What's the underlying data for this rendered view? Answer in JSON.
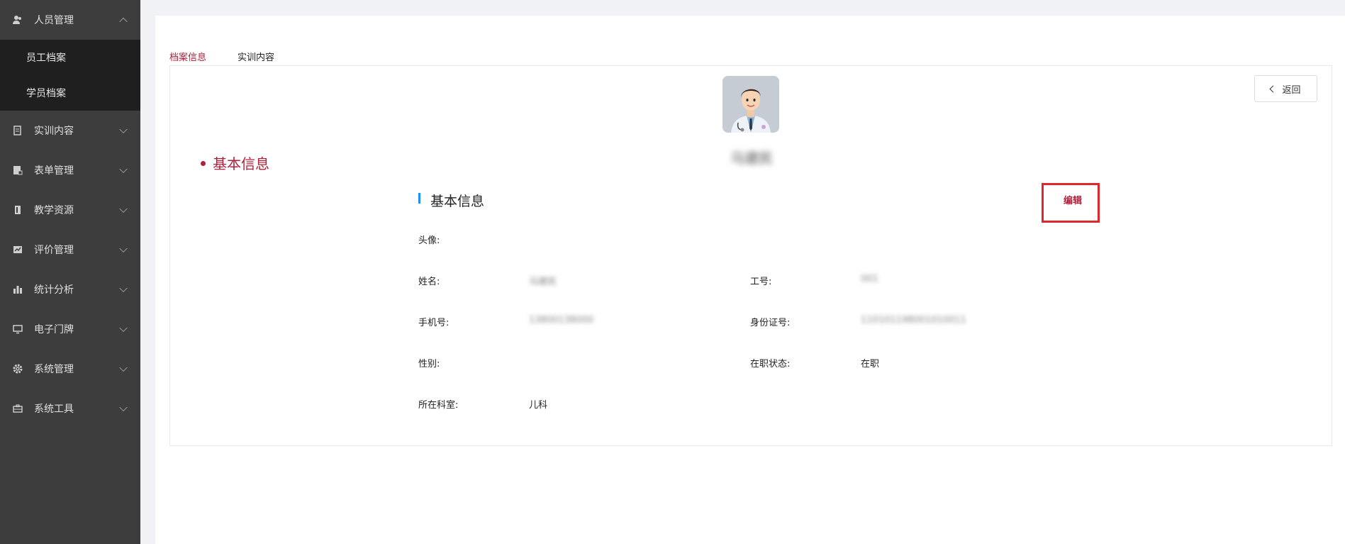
{
  "sidebar": {
    "items": [
      {
        "label": "人员管理",
        "icon": "user-group-icon",
        "expanded": true,
        "children": [
          {
            "label": "员工档案"
          },
          {
            "label": "学员档案"
          }
        ]
      },
      {
        "label": "实训内容",
        "icon": "document-icon"
      },
      {
        "label": "表单管理",
        "icon": "form-icon"
      },
      {
        "label": "教学资源",
        "icon": "book-icon"
      },
      {
        "label": "评价管理",
        "icon": "evaluation-icon"
      },
      {
        "label": "统计分析",
        "icon": "bar-chart-icon"
      },
      {
        "label": "电子门牌",
        "icon": "monitor-icon"
      },
      {
        "label": "系统管理",
        "icon": "gear-icon"
      },
      {
        "label": "系统工具",
        "icon": "toolbox-icon"
      }
    ]
  },
  "tabs": [
    {
      "label": "档案信息",
      "active": true
    },
    {
      "label": "实训内容",
      "active": false
    }
  ],
  "card": {
    "back_label": "返回",
    "profile_name": "马建民",
    "side_title": "基本信息",
    "section_title": "基本信息",
    "edit_label": "编辑",
    "fields": {
      "avatar_label": "头像:",
      "name_label": "姓名:",
      "name_value": "马建民",
      "id_label": "工号:",
      "id_value": "001",
      "phone_label": "手机号:",
      "phone_value": "13800138000",
      "idcard_label": "身份证号:",
      "idcard_value": "110101198001010011",
      "gender_label": "性别:",
      "gender_value": "",
      "status_label": "在职状态:",
      "status_value": "在职",
      "dept_label": "所在科室:",
      "dept_value": "儿科"
    }
  },
  "colors": {
    "accent": "#b0203a",
    "sidebar_bg": "#3d3d3d",
    "submenu_bg": "#1f1f1f",
    "highlight_box": "#e0272d",
    "section_bar": "#1890ff"
  }
}
